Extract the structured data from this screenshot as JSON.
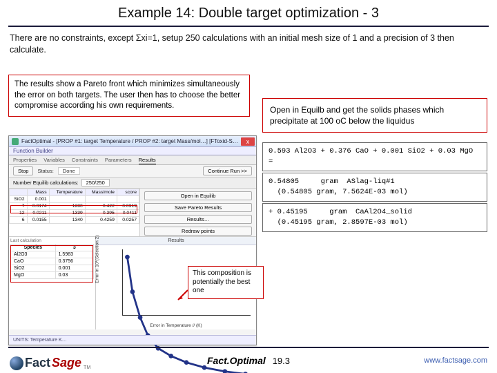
{
  "title": "Example 14: Double target optimization - 3",
  "intro": "There are no constraints, except Σxi=1, setup 250 calculations with an initial mesh size of 1 and a precision of 3 then calculate.",
  "red1": "The results show a Pareto front which minimizes simultaneously the error on both targets. The user then has to choose the better compromise according his own requirements.",
  "red2": "Open in Equilb and get the solids phases which precipitate at 100 oC below the liquidus",
  "res1": "0.593 Al2O3 +  0.376 CaO +  0.001 SiO2 + 0.03 MgO =",
  "res2": "0.54805     gram  ASlag-liq#1\n  (0.54805 gram, 7.5624E-03 mol)",
  "res3": "+ 0.45195     gram  CaAl2O4_solid\n  (0.45195 gram, 2.8597E-03 mol)",
  "app": {
    "title": "FactOptimal - [PROP #1: target Temperature / PROP #2: target Mass/mol…] [FToxid-S…",
    "close": "x",
    "subbar": "Function Builder",
    "tabs": {
      "t1": "Properties",
      "t2": "Variables",
      "t3": "Constraints",
      "t4": "Parameters",
      "t5": "Results"
    },
    "btn_stop": "Stop",
    "status_label": "Status:",
    "status_value": "Done",
    "btn_continue": "Continue Run >>",
    "calc_label": "Number Equilib calculations:",
    "calc_value": "250/250",
    "head": {
      "h1": "",
      "h2": "Mass",
      "h3": "Temperature",
      "h4": "Mass/mole",
      "h5": "score"
    },
    "row_top": {
      "c1": "SiO2",
      "c2": "0.001"
    },
    "rows": [
      {
        "a": "7",
        "b": "0.0174",
        "c": "1280",
        "d": "0.422",
        "e": "0.0319"
      },
      {
        "a": "12",
        "b": "0.0211",
        "c": "1339",
        "d": "0.395",
        "e": "0.0411"
      },
      {
        "a": "6",
        "b": "0.0155",
        "c": "1340",
        "d": "0.4259",
        "e": "0.0257"
      }
    ],
    "side": {
      "b1": "Open in Equilib",
      "b2": "Save Pareto Results",
      "b3": "Results…",
      "b4": "Redraw points"
    },
    "spec_hdr": {
      "h1": "Species",
      "h2": "3"
    },
    "spec": [
      {
        "s": "Al2O3",
        "v": "1.5983"
      },
      {
        "s": "CaO",
        "v": "0.3756"
      },
      {
        "s": "SiO2",
        "v": "0.001"
      },
      {
        "s": "MgO",
        "v": "0.03"
      }
    ],
    "spec_note": "Last calculation",
    "chart_title": "Results",
    "ylabel": "Error in 10*(Selection 2)",
    "xlabel": "Error in Temperature // (K)",
    "statusbar": "UNITS: Temperature K…"
  },
  "annotation": "This composition is potentially the best one",
  "footer": {
    "fact": "Fact",
    "sage": "Sage",
    "tm": "TM",
    "center_name": "Fact.Optimal",
    "center_num": "19.3",
    "url": "www.factsage.com"
  },
  "chart_data": {
    "type": "scatter",
    "title": "Results",
    "xlabel": "Error in Temperature // (K)",
    "ylabel": "Error in 10*(Selection 2)",
    "xlim": [
      0,
      5
    ],
    "ylim": [
      0,
      6
    ],
    "series": [
      {
        "name": "pareto",
        "x": [
          0.2,
          0.4,
          0.7,
          1.0,
          1.4,
          1.9,
          2.5,
          3.2,
          4.0,
          4.8
        ],
        "y": [
          5.6,
          4.0,
          2.8,
          2.0,
          1.4,
          1.0,
          0.7,
          0.45,
          0.3,
          0.2
        ]
      }
    ]
  }
}
